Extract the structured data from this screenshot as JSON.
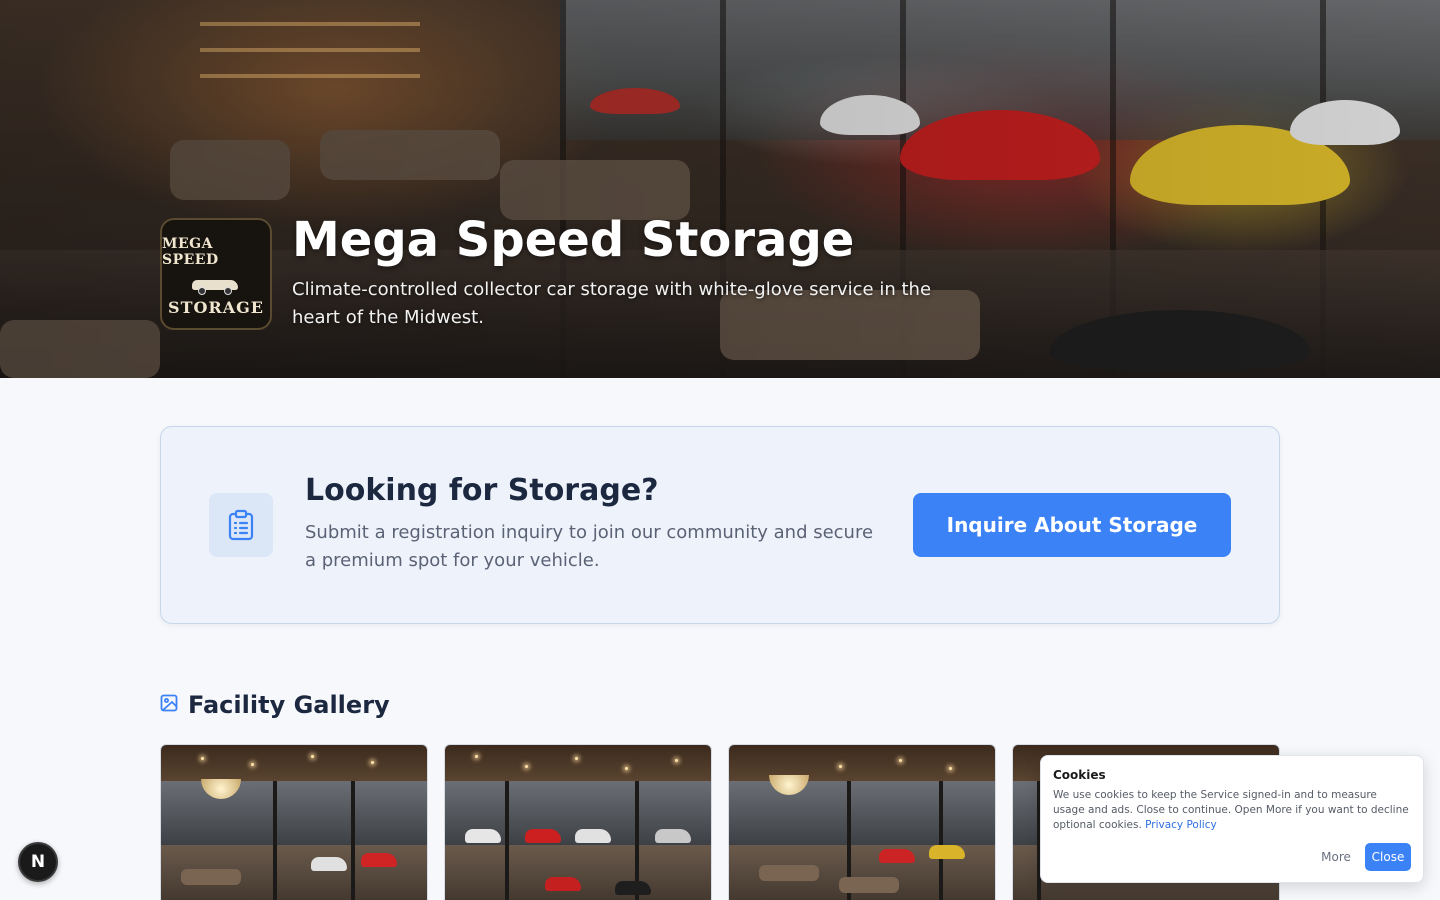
{
  "hero": {
    "logo": {
      "top_text": "MEGA SPEED",
      "bottom_text": "STORAGE"
    },
    "title": "Mega Speed Storage",
    "subtitle": "Climate-controlled collector car storage with white-glove service in the heart of the Midwest."
  },
  "inquiry": {
    "icon": "clipboard-list-icon",
    "title": "Looking for Storage?",
    "text": "Submit a registration inquiry to join our community and secure a premium spot for your vehicle.",
    "button_label": "Inquire About Storage"
  },
  "gallery": {
    "icon": "image-icon",
    "title": "Facility Gallery",
    "item_count": 4
  },
  "next_badge": {
    "label": "N"
  },
  "cookies": {
    "title": "Cookies",
    "text": "We use cookies to keep the Service signed-in and to measure usage and ads. Close to continue. Open More if you want to decline optional cookies.",
    "link_label": "Privacy Policy",
    "more_label": "More",
    "close_label": "Close"
  },
  "colors": {
    "accent": "#3b82f6",
    "page_background": "#f6f8fb",
    "card_background": "#eef3fb",
    "heading": "#1c2740",
    "body_text": "#5a6275"
  }
}
